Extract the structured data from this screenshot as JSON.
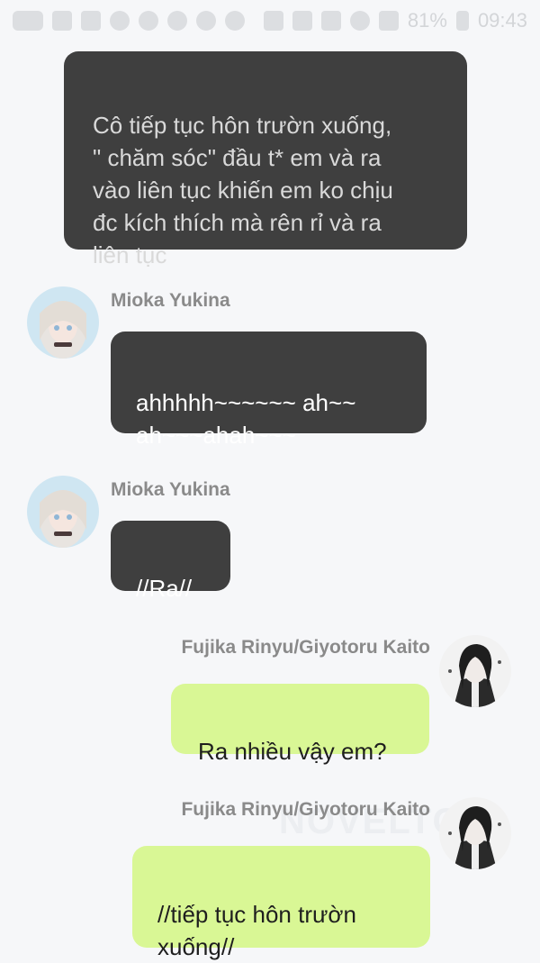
{
  "status_bar": {
    "battery": "81%",
    "time": "09:43"
  },
  "watermark": "NOVELTO",
  "messages": [
    {
      "type": "narration",
      "text": "Cô tiếp tục hôn trườn xuống,\n\" chăm sóc\" đầu t* em và ra\nvào liên tục khiến em ko chịu\nđc kích thích mà rên rỉ và ra\nliên tục"
    },
    {
      "type": "incoming",
      "sender": "Mioka Yukina",
      "avatar": "mioka-yukina-avatar",
      "text": "ahhhhh~~~~~~ ah~~\nah~~~ahah~~~"
    },
    {
      "type": "incoming",
      "sender": "Mioka Yukina",
      "avatar": "mioka-yukina-avatar",
      "text": "//Ra//"
    },
    {
      "type": "outgoing",
      "sender": "Fujika Rinyu/Giyotoru Kaito",
      "avatar": "fujika-rinyu-avatar",
      "text": "Ra nhiều vậy em?"
    },
    {
      "type": "outgoing",
      "sender": "Fujika Rinyu/Giyotoru Kaito",
      "avatar": "fujika-rinyu-avatar",
      "text": "//tiếp tục hôn trườn\nxuống//"
    }
  ]
}
